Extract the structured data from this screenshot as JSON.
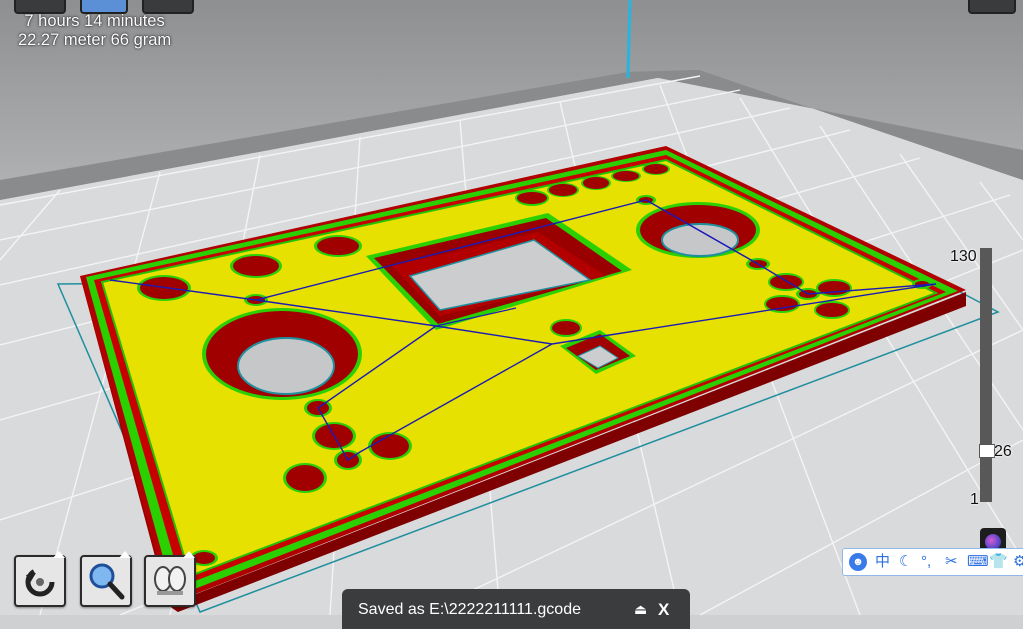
{
  "print_info": {
    "time": "7 hours 14 minutes",
    "material": "22.27 meter 66 gram"
  },
  "layer_slider": {
    "max": "130",
    "current": "26",
    "min": "1"
  },
  "toolbar": {
    "rotate_icon": "rotate-icon",
    "zoom_icon": "zoom-icon",
    "view_icon": "feet-icon"
  },
  "notification": {
    "text": "Saved as E:\\2222211111.gcode",
    "eject_glyph": "⏏",
    "close_glyph": "X"
  },
  "ime_toolbar": {
    "avatar": "☻",
    "lang": "中",
    "moon": "☾",
    "punct": "°,",
    "scissors": "✂",
    "keyboard": "⌨",
    "shirt": "👕",
    "gear": "⚙"
  },
  "colors": {
    "plate_top": "#e6e100",
    "plate_wall": "#a80000",
    "outline": "#22d000",
    "travel": "#1a1ab8",
    "build_volume": "#1f8f9e",
    "grid": "#e9e9ea",
    "axis": "#27b5e0"
  }
}
